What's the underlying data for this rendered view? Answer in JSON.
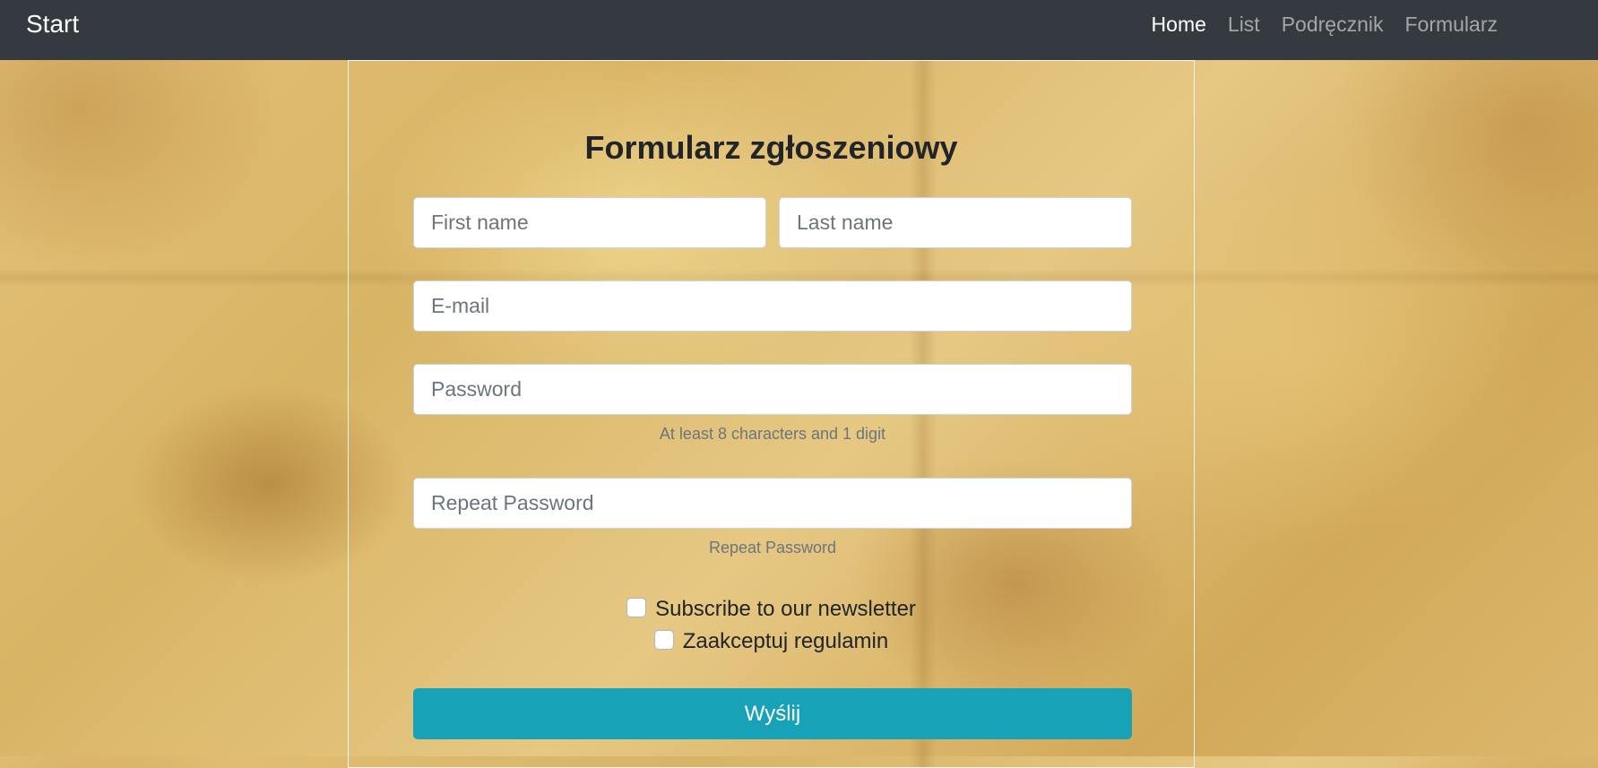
{
  "navbar": {
    "brand": "Start",
    "links": [
      {
        "label": "Home",
        "active": true
      },
      {
        "label": "List",
        "active": false
      },
      {
        "label": "Podręcznik",
        "active": false
      },
      {
        "label": "Formularz",
        "active": false
      }
    ]
  },
  "form": {
    "title": "Formularz zgłoszeniowy",
    "first_name": {
      "placeholder": "First name",
      "value": ""
    },
    "last_name": {
      "placeholder": "Last name",
      "value": ""
    },
    "email": {
      "placeholder": "E-mail",
      "value": ""
    },
    "password": {
      "placeholder": "Password",
      "value": "",
      "hint": "At least 8 characters and 1 digit"
    },
    "repeat_password": {
      "placeholder": "Repeat Password",
      "value": "",
      "hint": "Repeat Password"
    },
    "newsletter": {
      "label": "Subscribe to our newsletter",
      "checked": false
    },
    "terms": {
      "label": "Zaakceptuj regulamin",
      "checked": false
    },
    "submit_label": "Wyślij"
  },
  "colors": {
    "navbar_bg": "#343a40",
    "submit_bg": "#17a2b8"
  }
}
